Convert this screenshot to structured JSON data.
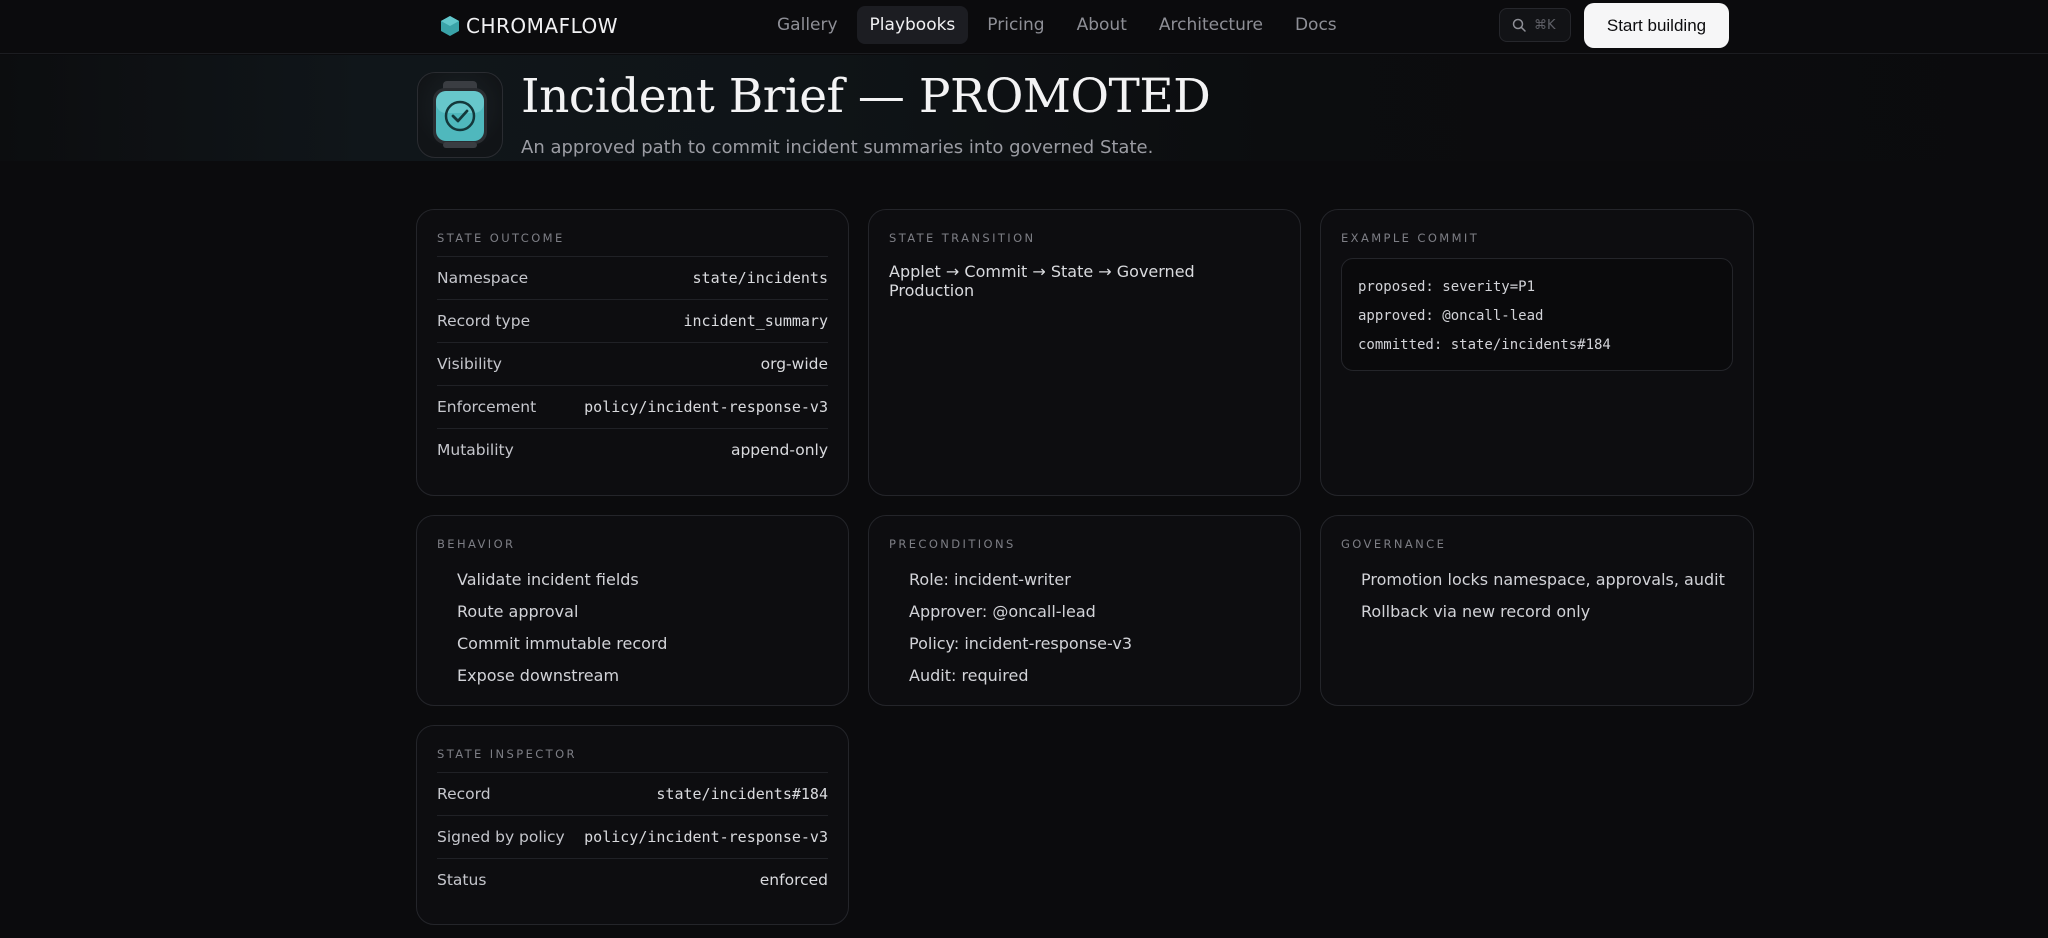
{
  "header": {
    "brand": "CHROMAFLOW",
    "nav": [
      "Gallery",
      "Playbooks",
      "Pricing",
      "About",
      "Architecture",
      "Docs"
    ],
    "active_nav": "Playbooks",
    "search_shortcut": "⌘K",
    "cta_label": "Start building"
  },
  "hero": {
    "title": "Incident Brief — PROMOTED",
    "subtitle": "An approved path to commit incident summaries into governed State."
  },
  "state_outcome": {
    "label": "STATE OUTCOME",
    "rows": [
      {
        "key": "Namespace",
        "value": "state/incidents"
      },
      {
        "key": "Record type",
        "value": "incident_summary"
      },
      {
        "key": "Visibility",
        "value": "org-wide"
      },
      {
        "key": "Enforcement",
        "value": "policy/incident-response-v3"
      },
      {
        "key": "Mutability",
        "value": "append-only"
      }
    ]
  },
  "state_transition": {
    "label": "STATE TRANSITION",
    "text": "Applet → Commit → State → Governed Production"
  },
  "example_commit": {
    "label": "EXAMPLE COMMIT",
    "lines": [
      "proposed: severity=P1",
      "approved: @oncall-lead",
      "committed: state/incidents#184"
    ]
  },
  "behavior": {
    "label": "BEHAVIOR",
    "items": [
      "Validate incident fields",
      "Route approval",
      "Commit immutable record",
      "Expose downstream"
    ]
  },
  "preconditions": {
    "label": "PRECONDITIONS",
    "items": [
      "Role: incident-writer",
      "Approver: @oncall-lead",
      "Policy: incident-response-v3",
      "Audit: required"
    ]
  },
  "governance": {
    "label": "GOVERNANCE",
    "items": [
      "Promotion locks namespace, approvals, audit",
      "Rollback via new record only"
    ]
  },
  "state_inspector": {
    "label": "STATE INSPECTOR",
    "rows": [
      {
        "key": "Record",
        "value": "state/incidents#184"
      },
      {
        "key": "Signed by policy",
        "value": "policy/incident-response-v3"
      },
      {
        "key": "Status",
        "value": "enforced"
      }
    ]
  },
  "colors": {
    "background": "#0b0b0d",
    "card_border": "#24252a",
    "accent_teal": "#4fb8bd",
    "cta_background": "#f6f6f7"
  },
  "icons": {
    "brand": "hexagon-logo-icon",
    "search": "search-icon",
    "hero": "check-badge-icon"
  }
}
